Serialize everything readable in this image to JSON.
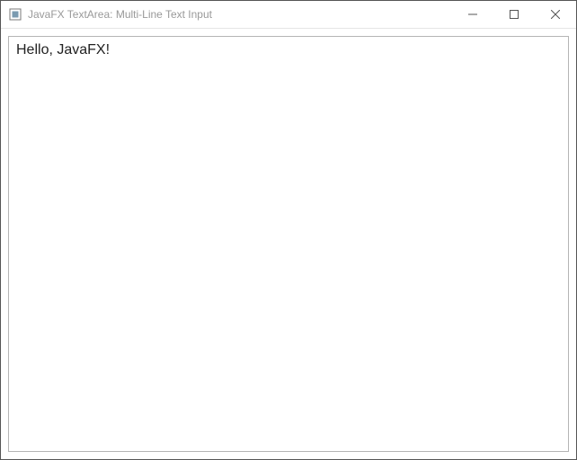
{
  "window": {
    "title": "JavaFX TextArea: Multi-Line Text Input"
  },
  "icons": {
    "app": "java-cup-icon",
    "minimize": "minimize-icon",
    "maximize": "maximize-icon",
    "close": "close-icon"
  },
  "main": {
    "textarea": {
      "value": "Hello, JavaFX!",
      "placeholder": ""
    }
  }
}
